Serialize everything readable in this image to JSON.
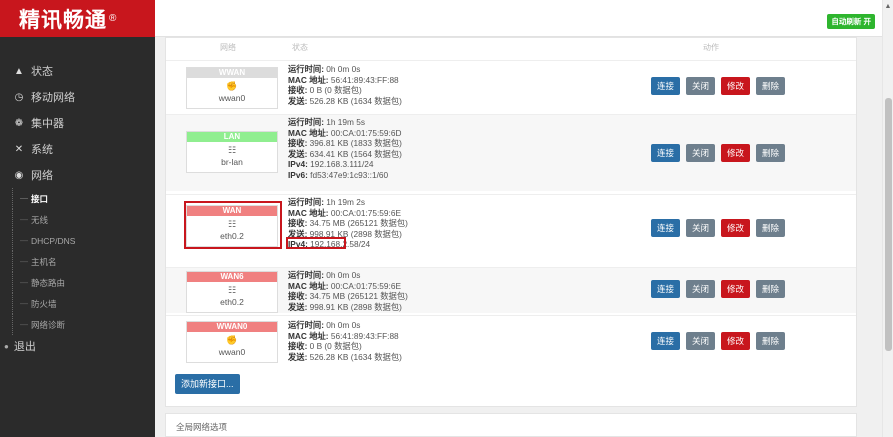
{
  "app": {
    "logo_text": "精讯畅通",
    "logo_mark": "®"
  },
  "topbar": {
    "auto_refresh": "自动刷新 开"
  },
  "sidebar": {
    "items": [
      {
        "label": "状态",
        "icon": "home-icon"
      },
      {
        "label": "移动网络",
        "icon": "clock-icon"
      },
      {
        "label": "集中器",
        "icon": "cluster-icon"
      },
      {
        "label": "系统",
        "icon": "wrench-icon"
      },
      {
        "label": "网络",
        "icon": "network-icon"
      }
    ],
    "subitems": [
      {
        "label": "接口",
        "active": true
      },
      {
        "label": "无线"
      },
      {
        "label": "DHCP/DNS"
      },
      {
        "label": "主机名"
      },
      {
        "label": "静态路由"
      },
      {
        "label": "防火墙"
      },
      {
        "label": "网络诊断"
      }
    ],
    "logout": "退出"
  },
  "table": {
    "headers": [
      "网络",
      "状态",
      "动作"
    ]
  },
  "interfaces": [
    {
      "name": "WWAN",
      "color": "#dcdcdc",
      "device": "wwan0",
      "lines": [
        {
          "label": "运行时间:",
          "value": " 0h 0m 0s"
        },
        {
          "label": "MAC 地址:",
          "value": " 56:41:89:43:FF:88"
        },
        {
          "label": "接收:",
          "value": " 0 B (0 数据包)"
        },
        {
          "label": "发送:",
          "value": " 526.28 KB (1634 数据包)"
        }
      ]
    },
    {
      "name": "LAN",
      "color": "#90ee90",
      "device": "br-lan",
      "lines": [
        {
          "label": "运行时间:",
          "value": " 1h 19m 5s"
        },
        {
          "label": "MAC 地址:",
          "value": " 00:CA:01:75:59:6D"
        },
        {
          "label": "接收:",
          "value": " 396.81 KB (1833 数据包)"
        },
        {
          "label": "发送:",
          "value": " 634.41 KB (1564 数据包)"
        },
        {
          "label": "IPv4:",
          "value": " 192.168.3.111/24"
        },
        {
          "label": "IPv6:",
          "value": " fd53:47e9:1c93::1/60"
        }
      ]
    },
    {
      "name": "WAN",
      "color": "#f08080",
      "device": "eth0.2",
      "lines": [
        {
          "label": "运行时间:",
          "value": " 1h 19m 2s"
        },
        {
          "label": "MAC 地址:",
          "value": " 00:CA:01:75:59:6E"
        },
        {
          "label": "接收:",
          "value": " 34.75 MB (265121 数据包)"
        },
        {
          "label": "发送:",
          "value": " 998.91 KB (2898 数据包)"
        },
        {
          "label": "IPv4:",
          "value": " 192.168.2.58/24"
        }
      ]
    },
    {
      "name": "WAN6",
      "color": "#f08080",
      "device": "eth0.2",
      "lines": [
        {
          "label": "运行时间:",
          "value": " 0h 0m 0s"
        },
        {
          "label": "MAC 地址:",
          "value": " 00:CA:01:75:59:6E"
        },
        {
          "label": "接收:",
          "value": " 34.75 MB (265121 数据包)"
        },
        {
          "label": "发送:",
          "value": " 998.91 KB (2898 数据包)"
        }
      ]
    },
    {
      "name": "WWAN0",
      "color": "#f08080",
      "device": "wwan0",
      "lines": [
        {
          "label": "运行时间:",
          "value": " 0h 0m 0s"
        },
        {
          "label": "MAC 地址:",
          "value": " 56:41:89:43:FF:88"
        },
        {
          "label": "接收:",
          "value": " 0 B (0 数据包)"
        },
        {
          "label": "发送:",
          "value": " 526.28 KB (1634 数据包)"
        }
      ]
    }
  ],
  "actions": {
    "connect": "连接",
    "close": "关闭",
    "edit": "修改",
    "delete": "删除"
  },
  "add_button": "添加新接口...",
  "global_options_title": "全局网络选项"
}
